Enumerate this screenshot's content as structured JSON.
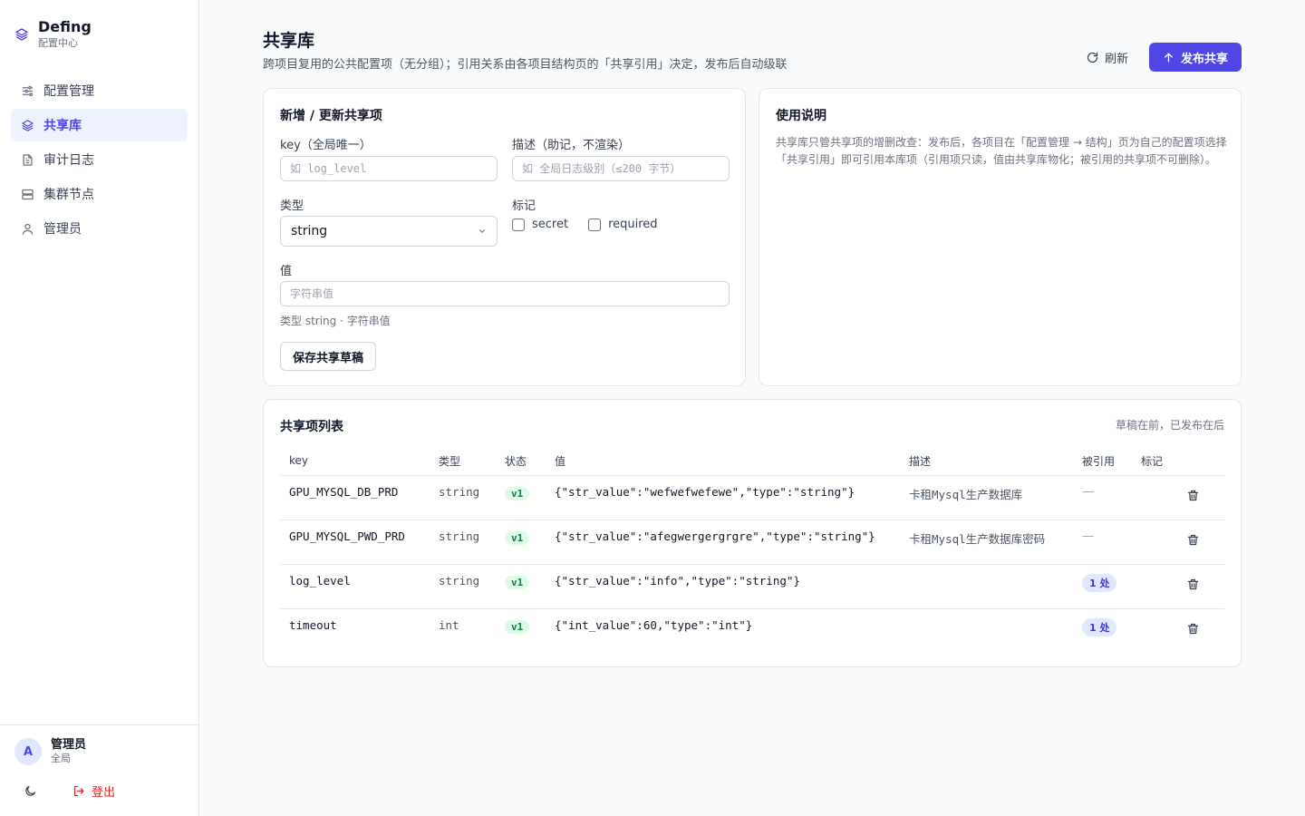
{
  "brand": {
    "name": "Defing",
    "subtitle": "配置中心"
  },
  "sidebar": {
    "items": [
      {
        "label": "配置管理",
        "icon": "sliders-icon",
        "active": false
      },
      {
        "label": "共享库",
        "icon": "layers-icon",
        "active": true
      },
      {
        "label": "审计日志",
        "icon": "file-text-icon",
        "active": false
      },
      {
        "label": "集群节点",
        "icon": "server-icon",
        "active": false
      },
      {
        "label": "管理员",
        "icon": "user-icon",
        "active": false
      }
    ]
  },
  "user": {
    "avatar": "A",
    "name": "管理员",
    "scope": "全局"
  },
  "footer": {
    "logout_label": "登出"
  },
  "header": {
    "title": "共享库",
    "subtitle": "跨项目复用的公共配置项（无分组）；引用关系由各项目结构页的「共享引用」决定，发布后自动级联",
    "refresh_label": "刷新",
    "publish_label": "发布共享"
  },
  "form": {
    "title": "新增 / 更新共享项",
    "key_label": "key（全局唯一）",
    "key_placeholder": "如 log_level",
    "desc_label": "描述（助记，不渲染）",
    "desc_placeholder": "如 全局日志级别（≤200 字节）",
    "type_label": "类型",
    "type_value": "string",
    "flags_label": "标记",
    "flag_secret": "secret",
    "flag_required": "required",
    "value_label": "值",
    "value_placeholder": "字符串值",
    "hint": "类型 string · 字符串值",
    "save_label": "保存共享草稿"
  },
  "help": {
    "title": "使用说明",
    "text": "共享库只管共享项的增删改查：发布后，各项目在「配置管理 → 结构」页为自己的配置项选择「共享引用」即可引用本库项（引用项只读，值由共享库物化；被引用的共享项不可删除）。"
  },
  "list": {
    "title": "共享项列表",
    "note": "草稿在前，已发布在后",
    "columns": [
      "key",
      "类型",
      "状态",
      "值",
      "描述",
      "被引用",
      "标记"
    ],
    "rows": [
      {
        "key": "GPU_MYSQL_DB_PRD",
        "type": "string",
        "status": "v1",
        "value": "{\"str_value\":\"wefwefwefewe\",\"type\":\"string\"}",
        "desc": "卡租Mysql生产数据库",
        "refs": "—",
        "referenced": false
      },
      {
        "key": "GPU_MYSQL_PWD_PRD",
        "type": "string",
        "status": "v1",
        "value": "{\"str_value\":\"afegwergergrgre\",\"type\":\"string\"}",
        "desc": "卡租Mysql生产数据库密码",
        "refs": "—",
        "referenced": false
      },
      {
        "key": "log_level",
        "type": "string",
        "status": "v1",
        "value": "{\"str_value\":\"info\",\"type\":\"string\"}",
        "desc": "",
        "refs": "1 处",
        "referenced": true
      },
      {
        "key": "timeout",
        "type": "int",
        "status": "v1",
        "value": "{\"int_value\":60,\"type\":\"int\"}",
        "desc": "",
        "refs": "1 处",
        "referenced": true
      }
    ]
  },
  "colors": {
    "accent": "#4f46e5",
    "danger": "#dc2626",
    "status_bg": "#dcfce7",
    "status_fg": "#15803d"
  }
}
